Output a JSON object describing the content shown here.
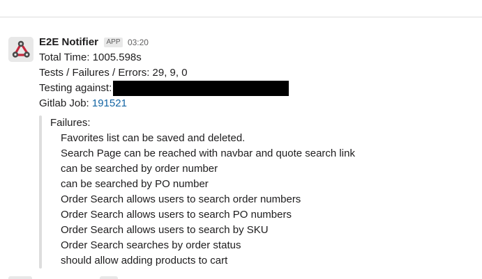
{
  "message": {
    "sender": "E2E Notifier",
    "badge": "APP",
    "time": "03:20",
    "lines": {
      "total_time": "Total Time: 1005.598s",
      "tests": "Tests / Failures / Errors: 29, 9, 0",
      "testing_against_label": "Testing against:",
      "gitlab_label": "Gitlab Job: ",
      "gitlab_job": "191521"
    },
    "quote": {
      "heading": "Failures:",
      "items": [
        "Favorites list can be saved and deleted.",
        "Search Page can be reached with navbar and quote search link",
        "can be searched by order number",
        "can be searched by PO number",
        "Order Search allows users to search order numbers",
        "Order Search allows users to search PO numbers",
        "Order Search allows users to search by SKU",
        "Order Search searches by order status",
        "should allow adding products to cart"
      ]
    }
  },
  "colors": {
    "link": "#1264a3",
    "text": "#1d1c1d",
    "muted": "#616061"
  },
  "icons": {
    "avatar": "webhook-icon"
  }
}
